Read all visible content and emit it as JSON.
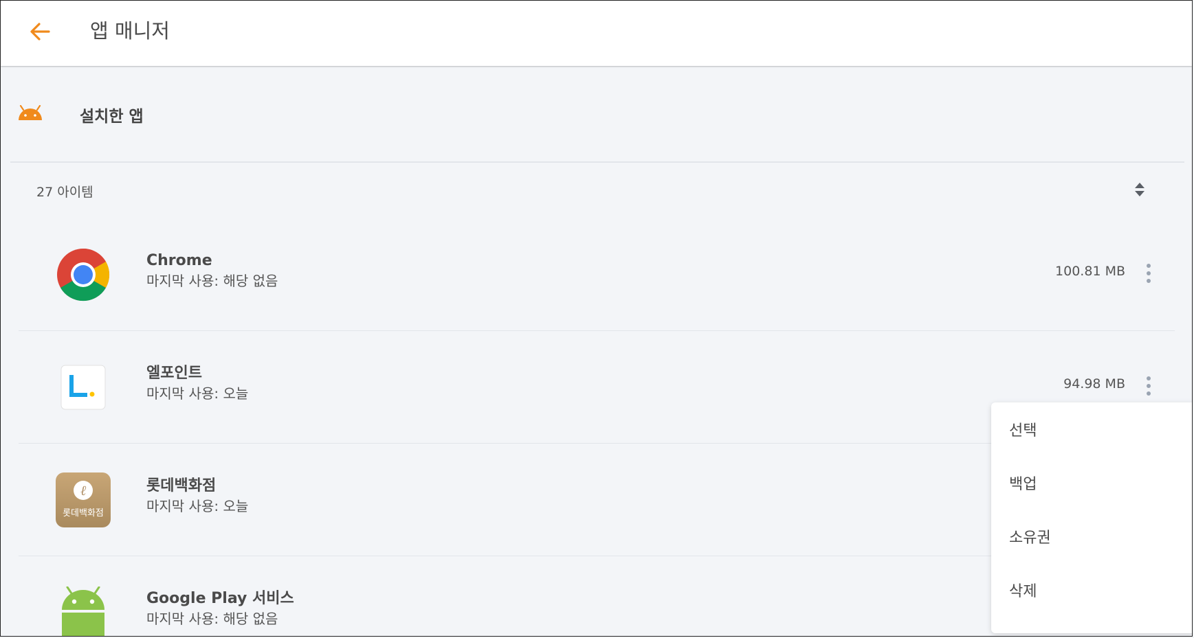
{
  "appbar": {
    "title": "앱 매니저",
    "back_icon": "arrow-left-icon",
    "accent_color": "#f08a1c"
  },
  "section": {
    "icon": "android-icon",
    "title": "설치한 앱"
  },
  "list": {
    "count_label": "27 아이템",
    "sort_icon": "sort-icon",
    "apps": [
      {
        "name": "Chrome",
        "last_used": "마지막 사용: 해당 없음",
        "size": "100.81 MB",
        "icon": "chrome-icon"
      },
      {
        "name": "엘포인트",
        "last_used": "마지막 사용: 오늘",
        "size": "94.98 MB",
        "icon": "lpoint-icon"
      },
      {
        "name": "롯데백화점",
        "last_used": "마지막 사용: 오늘",
        "size": "",
        "icon": "lotte-department-store-icon",
        "icon_label": "롯데백화점"
      },
      {
        "name": "Google Play 서비스",
        "last_used": "마지막 사용: 해당 없음",
        "size": "",
        "icon": "android-robot-icon"
      }
    ]
  },
  "context_menu": {
    "items": [
      "선택",
      "백업",
      "소유권",
      "삭제"
    ]
  }
}
